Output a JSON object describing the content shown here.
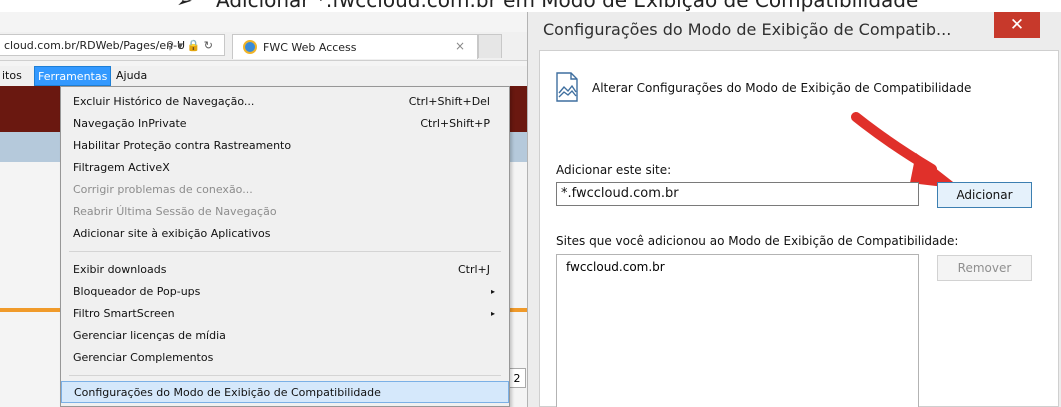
{
  "heading": {
    "bullet": "➢",
    "text": "Adicionar *.fwccloud.com.br em Modo de Exibição de Compatibilidade"
  },
  "browser": {
    "address": "cloud.com.br/RDWeb/Pages/en-U",
    "address_icons": "⚲ ▾ 🔒 ↻",
    "tab_title": "FWC Web Access",
    "tab_close": "×",
    "menubar": {
      "left_fragment": "itos",
      "tools": "Ferramentas",
      "help": "Ajuda"
    },
    "page_number": "2",
    "tools_menu": [
      {
        "label": "Excluir Histórico de Navegação...",
        "shortcut": "Ctrl+Shift+Del"
      },
      {
        "label": "Navegação InPrivate",
        "shortcut": "Ctrl+Shift+P"
      },
      {
        "label": "Habilitar Proteção contra Rastreamento"
      },
      {
        "label": "Filtragem ActiveX"
      },
      {
        "label": "Corrigir problemas de conexão..."
      },
      {
        "label": "Reabrir Última Sessão de Navegação"
      },
      {
        "label": "Adicionar site à exibição Aplicativos"
      },
      {
        "label": "Exibir downloads",
        "shortcut": "Ctrl+J"
      },
      {
        "label": "Bloqueador de Pop-ups",
        "arrow": "▸"
      },
      {
        "label": "Filtro SmartScreen",
        "arrow": "▸"
      },
      {
        "label": "Gerenciar licenças de mídia"
      },
      {
        "label": "Gerenciar Complementos"
      },
      {
        "label": "Configurações do Modo de Exibição de Compatibilidade"
      }
    ]
  },
  "dialog": {
    "title": "Configurações do Modo de Exibição de Compatib...",
    "close": "✕",
    "description": "Alterar Configurações do Modo de Exibição de Compatibilidade",
    "add_label": "Adicionar este site:",
    "add_value": "*.fwccloud.com.br",
    "add_button": "Adicionar",
    "list_label": "Sites que você adicionou ao Modo de Exibição de Compatibilidade:",
    "sites": [
      "fwccloud.com.br"
    ],
    "remove_button": "Remover"
  },
  "colors": {
    "close_red": "#c7392b",
    "menu_highlight": "#3399ff",
    "arrow_red": "#e0302a"
  }
}
